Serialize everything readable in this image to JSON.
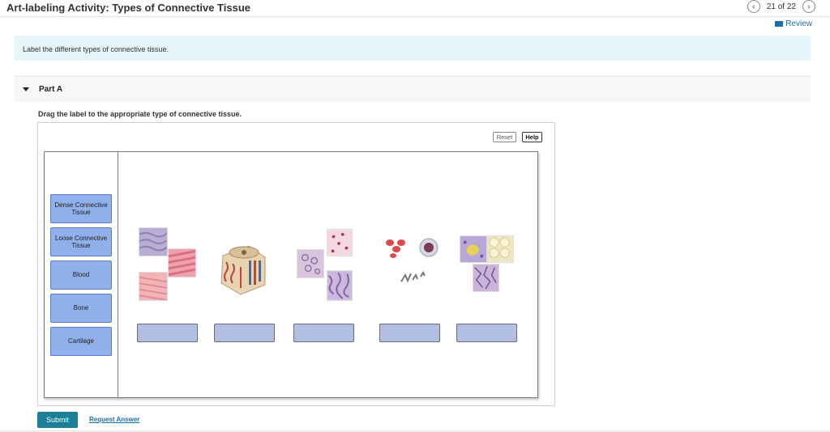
{
  "header": {
    "title": "Art-labeling Activity: Types of Connective Tissue",
    "counter": "21 of 22",
    "review_label": "Review"
  },
  "intro": {
    "text": "Label the different types of connective tissue."
  },
  "part": {
    "title": "Part A",
    "prompt": "Drag the label to the appropriate type of connective tissue."
  },
  "toolbar": {
    "reset_label": "Reset",
    "help_label": "Help"
  },
  "labels": [
    "Dense Connective Tissue",
    "Loose Connective Tissue",
    "Blood",
    "Bone",
    "Cartilage"
  ],
  "actions": {
    "submit_label": "Submit",
    "request_answer_label": "Request Answer"
  },
  "icons": {
    "prev": "chevron-left-icon",
    "next": "chevron-right-icon",
    "review": "review-icon",
    "part_toggle": "triangle-down-icon"
  },
  "colors": {
    "label_tile": "#8fb0ea",
    "drop_zone": "#b1bfe4",
    "submit": "#1a7f97",
    "link": "#1b6fa8",
    "intro_bg": "#e6f5f7"
  }
}
